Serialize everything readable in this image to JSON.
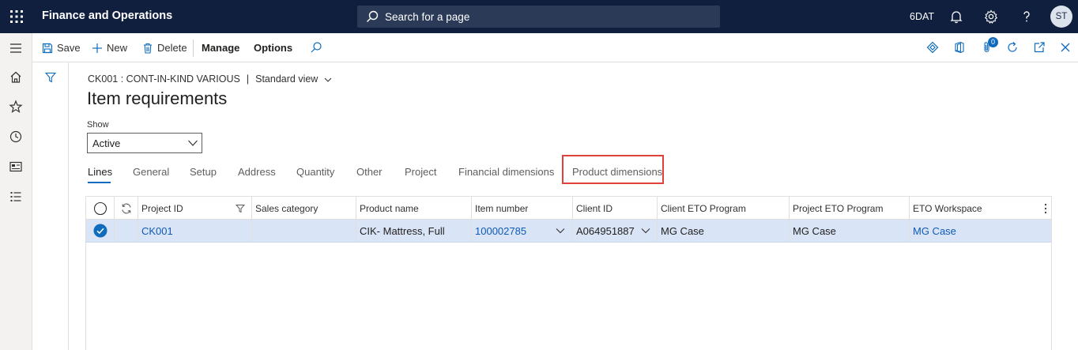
{
  "app": {
    "title": "Finance and Operations"
  },
  "search": {
    "placeholder": "Search for a page"
  },
  "topbar": {
    "company": "6DAT",
    "user_initials": "ST"
  },
  "actionpane": {
    "save": "Save",
    "new": "New",
    "delete": "Delete",
    "manage": "Manage",
    "options": "Options",
    "attachments_count": "0"
  },
  "breadcrumb": {
    "record": "CK001 : CONT-IN-KIND VARIOUS",
    "separator": "|",
    "view": "Standard view"
  },
  "page": {
    "title": "Item requirements"
  },
  "show": {
    "label": "Show",
    "value": "Active"
  },
  "tabs": [
    {
      "label": "Lines"
    },
    {
      "label": "General"
    },
    {
      "label": "Setup"
    },
    {
      "label": "Address"
    },
    {
      "label": "Quantity"
    },
    {
      "label": "Other"
    },
    {
      "label": "Project"
    },
    {
      "label": "Financial dimensions"
    },
    {
      "label": "Product dimensions"
    }
  ],
  "grid": {
    "columns": [
      "Project ID",
      "Sales category",
      "Product name",
      "Item number",
      "Client ID",
      "Client ETO Program",
      "Project ETO Program",
      "ETO Workspace"
    ],
    "rows": [
      {
        "project_id": "CK001",
        "sales_category": "",
        "product_name": "CIK- Mattress, Full",
        "item_number": "100002785",
        "client_id": "A064951887",
        "client_eto_program": "MG Case",
        "project_eto_program": "MG Case",
        "eto_workspace": "MG Case"
      }
    ]
  },
  "colors": {
    "topbar": "#0f1f3d",
    "accent": "#0f6cbd",
    "selected_row": "#d9e4f6",
    "highlight": "#e0413a"
  }
}
